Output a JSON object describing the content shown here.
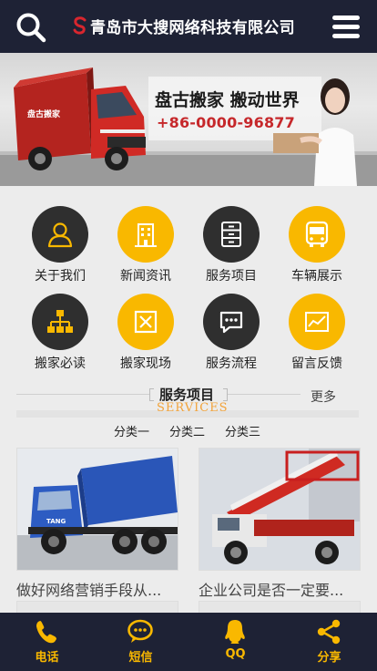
{
  "header": {
    "company": "青岛市大搜网络科技有限公司",
    "search_icon": "search-icon",
    "menu_icon": "hamburger-menu-icon"
  },
  "banner": {
    "slogan": "盘古搬家 搬动世界",
    "phone": "+86-0000-96877",
    "truck_text": "盘古搬家"
  },
  "nav": [
    {
      "label": "关于我们",
      "icon": "user-icon",
      "style": "dark"
    },
    {
      "label": "新闻资讯",
      "icon": "building-icon",
      "style": "yellow"
    },
    {
      "label": "服务项目",
      "icon": "cabinet-icon",
      "style": "dark"
    },
    {
      "label": "车辆展示",
      "icon": "bus-icon",
      "style": "yellow"
    },
    {
      "label": "搬家必读",
      "icon": "org-chart-icon",
      "style": "dark"
    },
    {
      "label": "搬家现场",
      "icon": "frame-icon",
      "style": "yellow"
    },
    {
      "label": "服务流程",
      "icon": "chat-icon",
      "style": "dark"
    },
    {
      "label": "留言反馈",
      "icon": "chart-icon",
      "style": "yellow"
    }
  ],
  "section": {
    "title": "服务项目",
    "subtitle": "SERVICES",
    "more": "更多"
  },
  "categories": [
    "分类一",
    "分类二",
    "分类三"
  ],
  "cards": [
    {
      "caption": "做好网络营销手段从..."
    },
    {
      "caption": "企业公司是否一定要..."
    }
  ],
  "footer": [
    {
      "label": "电话",
      "icon": "phone-icon"
    },
    {
      "label": "短信",
      "icon": "sms-icon"
    },
    {
      "label": "QQ",
      "icon": "qq-icon"
    },
    {
      "label": "分享",
      "icon": "share-icon"
    }
  ],
  "colors": {
    "header_bg": "#1e2235",
    "accent_yellow": "#f9b800",
    "dark_circle": "#2f2f2f",
    "brand_red": "#c6282b"
  }
}
